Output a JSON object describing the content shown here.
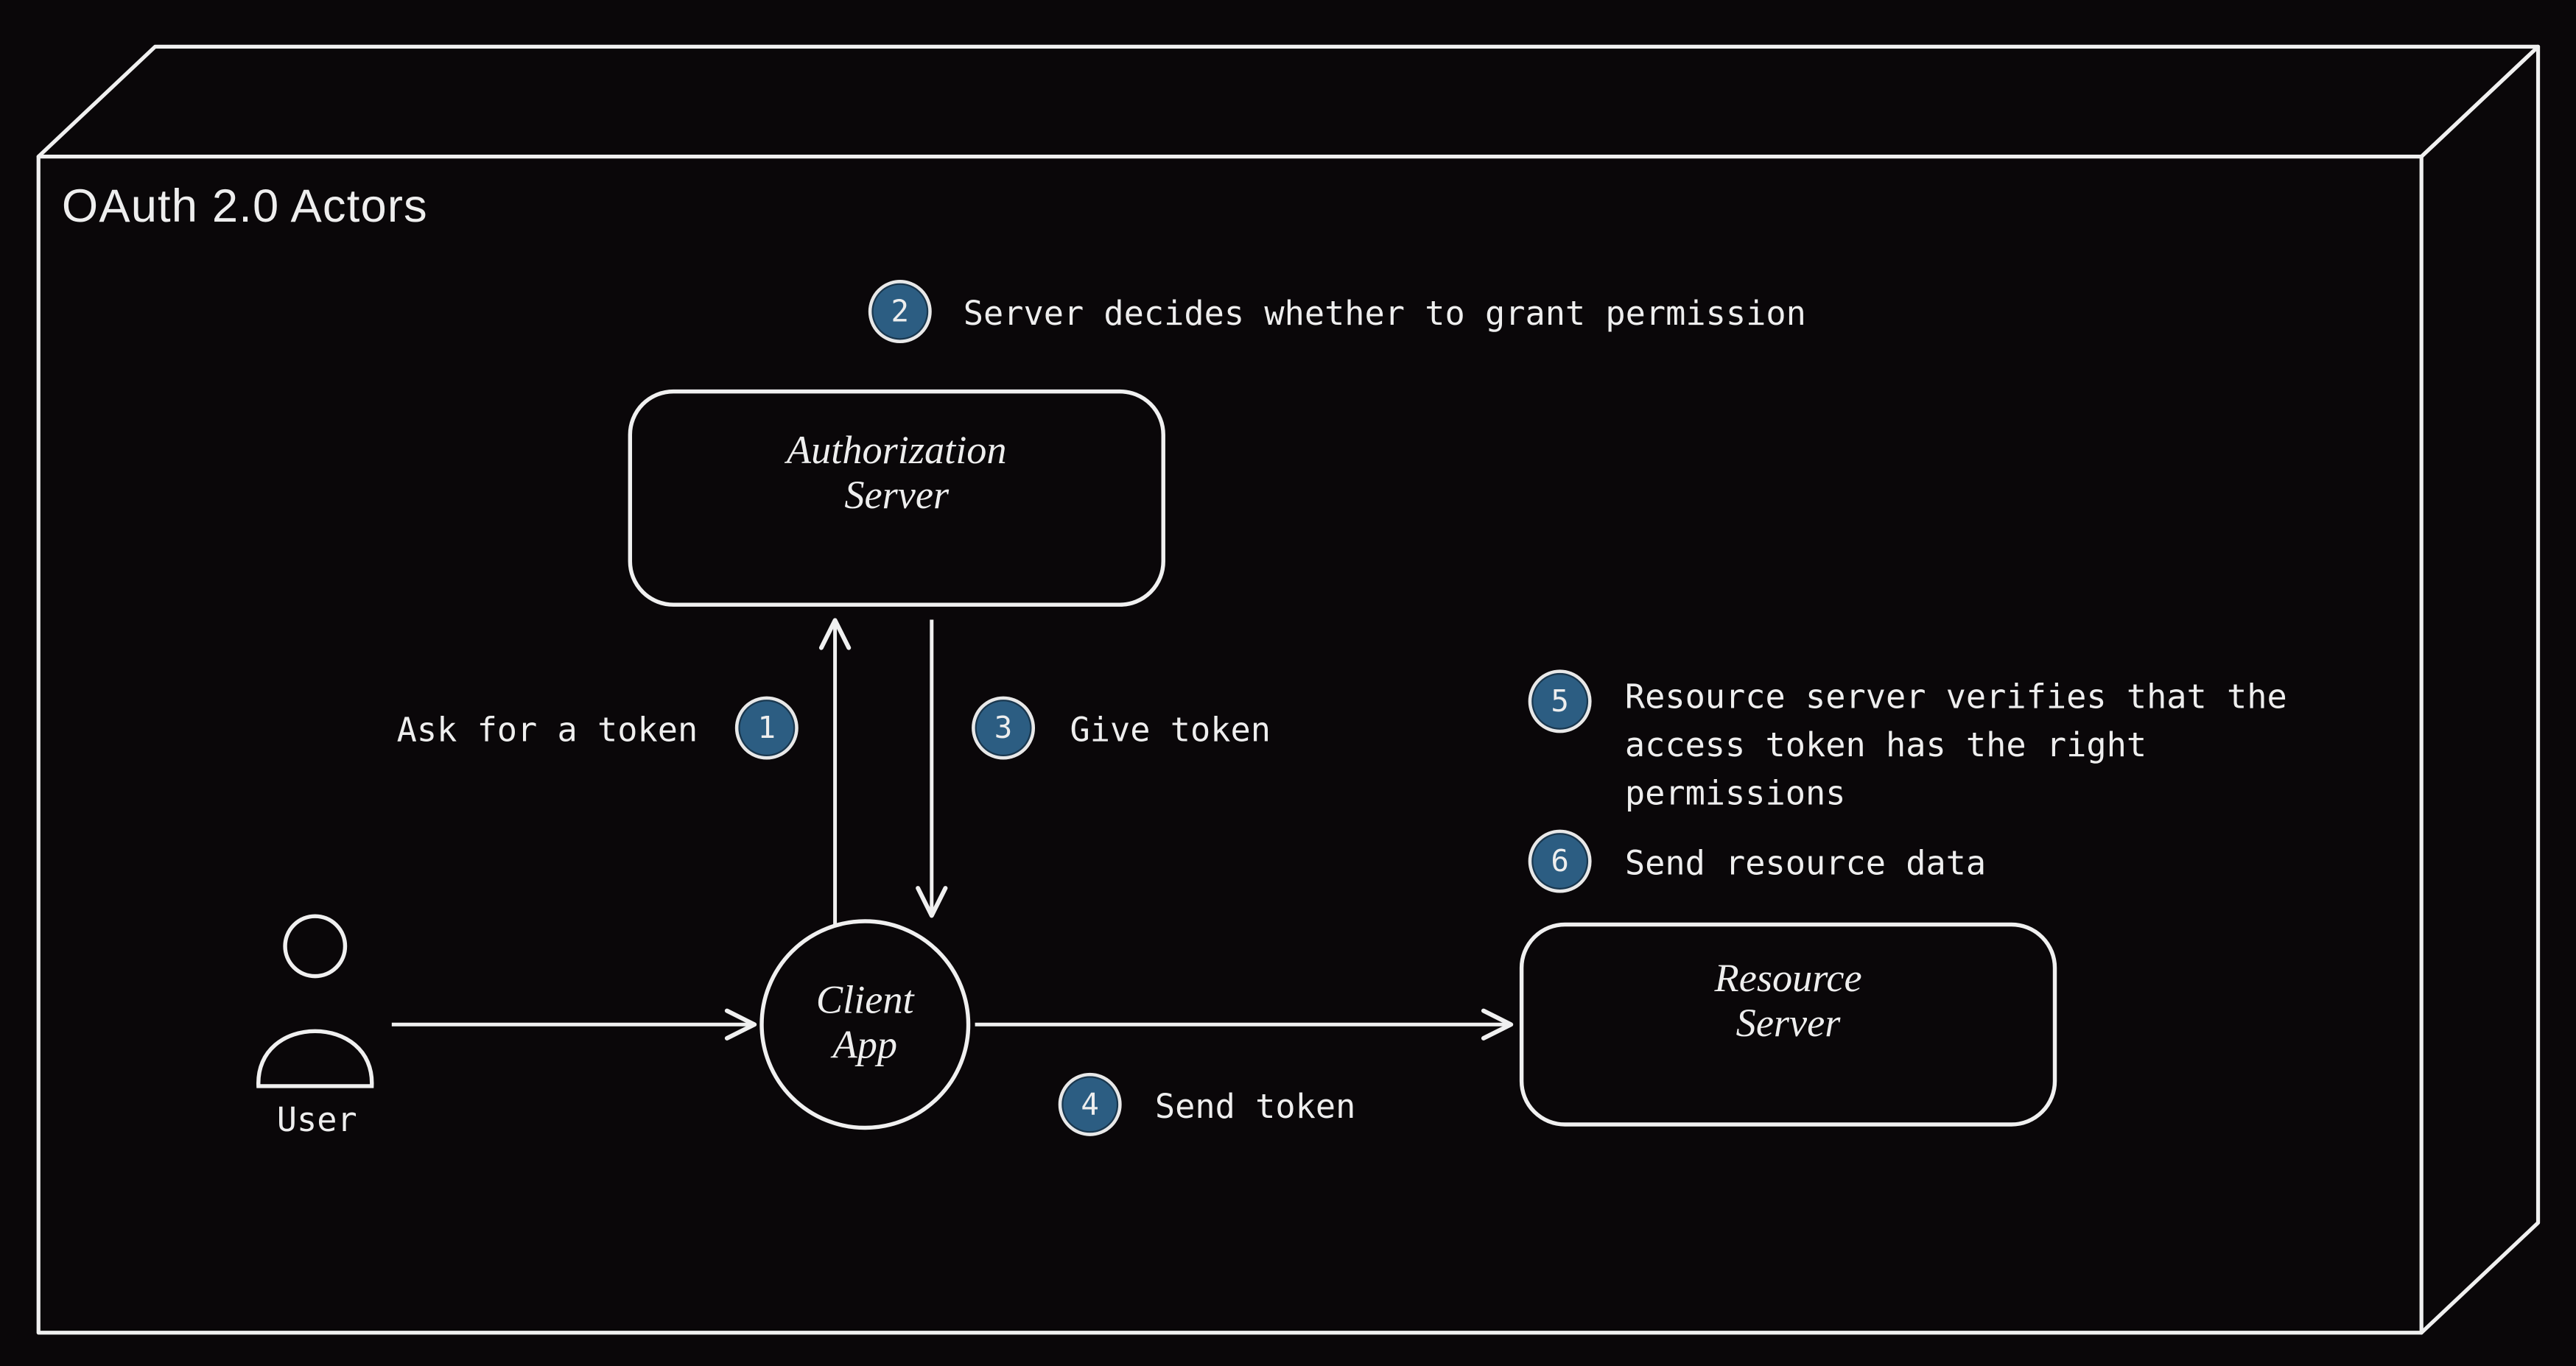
{
  "title": "OAuth 2.0 Actors",
  "nodes": {
    "user_label": "User",
    "client_line1": "Client",
    "client_line2": "App",
    "auth_line1": "Authorization",
    "auth_line2": "Server",
    "resource_line1": "Resource",
    "resource_line2": "Server"
  },
  "steps": {
    "s1": {
      "num": "1",
      "text": "Ask for a token"
    },
    "s2": {
      "num": "2",
      "text": "Server decides whether to grant permission"
    },
    "s3": {
      "num": "3",
      "text": "Give token"
    },
    "s4": {
      "num": "4",
      "text": "Send token"
    },
    "s5": {
      "num": "5",
      "text": "Resource server verifies that the access token has the right permissions"
    },
    "s6": {
      "num": "6",
      "text": "Send resource data"
    }
  },
  "colors": {
    "bg": "#0a0709",
    "stroke": "#f0f0f0",
    "badge_fill": "#2c5d82"
  }
}
